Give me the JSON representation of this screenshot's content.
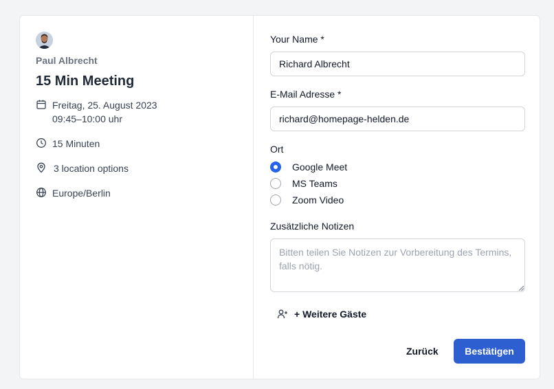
{
  "host": {
    "name": "Paul Albrecht"
  },
  "event": {
    "title": "15 Min Meeting",
    "date_line1": "Freitag, 25. August 2023",
    "date_line2": "09:45–10:00 uhr",
    "duration": "15 Minuten",
    "locations": "3 location options",
    "timezone": "Europe/Berlin"
  },
  "form": {
    "name_label": "Your Name *",
    "name_value": "Richard Albrecht",
    "email_label": "E-Mail Adresse *",
    "email_value": "richard@homepage-helden.de",
    "location_label": "Ort",
    "options": [
      {
        "label": "Google Meet",
        "selected": true
      },
      {
        "label": "MS Teams",
        "selected": false
      },
      {
        "label": "Zoom Video",
        "selected": false
      }
    ],
    "notes_label": "Zusätzliche Notizen",
    "notes_placeholder": "Bitten teilen Sie Notizen zur Vorbereitung des Termins, falls nötig.",
    "guests_label": "+ Weitere Gäste",
    "back_label": "Zurück",
    "confirm_label": "Bestätigen"
  },
  "colors": {
    "accent": "#2d5fd0",
    "border": "#e5e7eb"
  }
}
